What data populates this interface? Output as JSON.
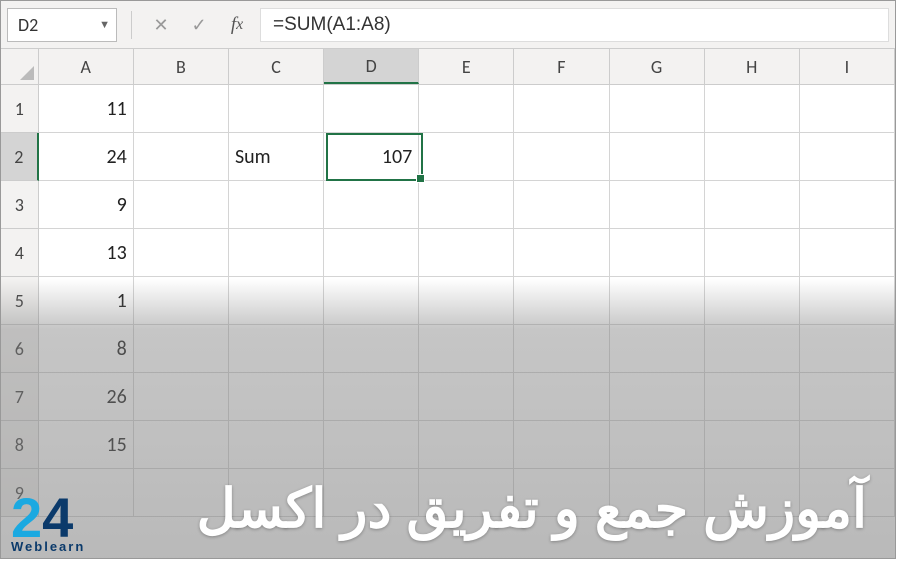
{
  "formula_bar": {
    "name_box_value": "D2",
    "formula_value": "=SUM(A1:A8)"
  },
  "columns": [
    "A",
    "B",
    "C",
    "D",
    "E",
    "F",
    "G",
    "H",
    "I"
  ],
  "active_column_index": 3,
  "active_row_index": 1,
  "rows": [
    {
      "header": "1",
      "cells": {
        "A": "11"
      }
    },
    {
      "header": "2",
      "cells": {
        "A": "24",
        "C": "Sum",
        "D": "107"
      }
    },
    {
      "header": "3",
      "cells": {
        "A": "9"
      }
    },
    {
      "header": "4",
      "cells": {
        "A": "13"
      }
    },
    {
      "header": "5",
      "cells": {
        "A": "1"
      }
    },
    {
      "header": "6",
      "cells": {
        "A": "8"
      }
    },
    {
      "header": "7",
      "cells": {
        "A": "26"
      }
    },
    {
      "header": "8",
      "cells": {
        "A": "15"
      }
    },
    {
      "header": "9",
      "cells": {}
    }
  ],
  "selection": {
    "row": 1,
    "col": 3
  },
  "caption_text": "آموزش جمع و تفریق در اکسل",
  "logo": {
    "part1": "2",
    "part2": "4",
    "sub": "Weblearn"
  }
}
